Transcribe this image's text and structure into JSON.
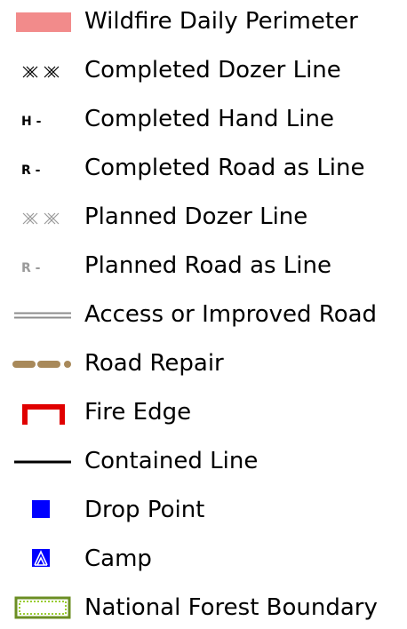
{
  "legend": {
    "items": [
      {
        "label": "Wildfire Daily Perimeter",
        "icon": "wildfire-perimeter-fill-icon",
        "color": "#f28b8b"
      },
      {
        "label": "Completed Dozer Line",
        "icon": "completed-dozer-line-icon",
        "color": "#000000"
      },
      {
        "label": "Completed Hand Line",
        "icon": "completed-hand-line-icon",
        "color": "#000000",
        "glyph": "H -"
      },
      {
        "label": "Completed Road as Line",
        "icon": "completed-road-as-line-icon",
        "color": "#000000",
        "glyph": "R -"
      },
      {
        "label": "Planned Dozer Line",
        "icon": "planned-dozer-line-icon",
        "color": "#9a9a9a"
      },
      {
        "label": "Planned Road as Line",
        "icon": "planned-road-as-line-icon",
        "color": "#9a9a9a",
        "glyph": "R -"
      },
      {
        "label": "Access or Improved Road",
        "icon": "access-road-icon",
        "color": "#8c8c8c"
      },
      {
        "label": "Road Repair",
        "icon": "road-repair-icon",
        "color": "#a8895a"
      },
      {
        "label": "Fire Edge",
        "icon": "fire-edge-icon",
        "color": "#e00000"
      },
      {
        "label": "Contained Line",
        "icon": "contained-line-icon",
        "color": "#000000"
      },
      {
        "label": "Drop Point",
        "icon": "drop-point-icon",
        "color": "#0000ff"
      },
      {
        "label": "Camp",
        "icon": "camp-icon",
        "color": "#0000ff"
      },
      {
        "label": "National Forest Boundary",
        "icon": "national-forest-boundary-icon",
        "color": "#6b8e23"
      }
    ]
  }
}
